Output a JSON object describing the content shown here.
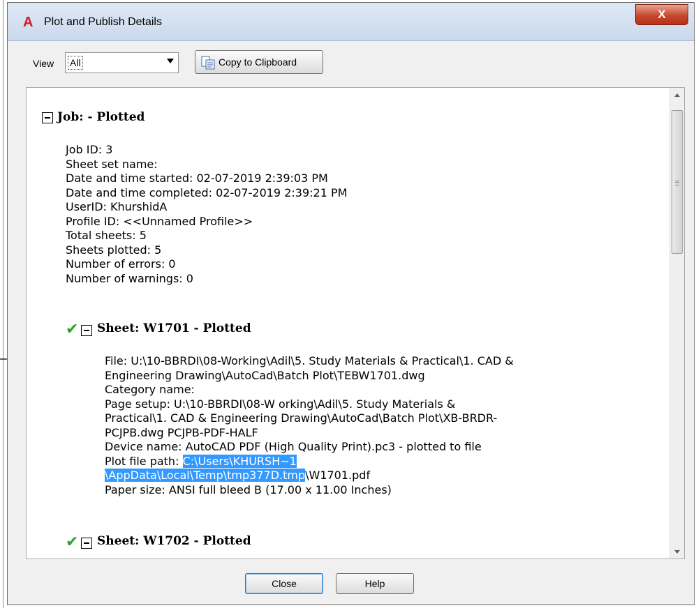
{
  "window": {
    "title": "Plot and Publish Details",
    "close_glyph": "X",
    "app_icon": "autocad-a-icon"
  },
  "toolbar": {
    "view_label": "View",
    "view_value": "All",
    "copy_label": "Copy to Clipboard"
  },
  "job": {
    "heading": "Job: - Plotted",
    "lines": [
      "Job ID: 3",
      "Sheet set name:",
      "Date and time started: 02-07-2019 2:39:03 PM",
      "Date and time completed: 02-07-2019 2:39:21 PM",
      "UserID: KhurshidA",
      "Profile ID: <<Unnamed Profile>>",
      "Total sheets: 5",
      "Sheets plotted: 5",
      "Number of errors: 0",
      "Number of warnings: 0"
    ]
  },
  "sheet1": {
    "heading": "Sheet: W1701 - Plotted",
    "lines": [
      "File: U:\\10-BBRDI\\08-Working\\Adil\\5. Study Materials & Practical\\1. CAD &",
      "Engineering Drawing\\AutoCad\\Batch Plot\\TEBW1701.dwg",
      "Category name:",
      "Page setup: U:\\10-BBRDI\\08-W orking\\Adil\\5. Study Materials &",
      "Practical\\1. CAD & Engineering Drawing\\AutoCad\\Batch Plot\\XB-BRDR-",
      "PCJPB.dwg PCJPB-PDF-HALF",
      "Device name: AutoCAD PDF (High Quality Print).pc3 - plotted to file"
    ],
    "plot_path_label": "Plot file path: ",
    "plot_path_hl1": "C:\\Users\\KHURSH~1",
    "plot_path_hl2": "\\AppData\\Local\\Temp\\tmp377D.tmp",
    "plot_path_rest": "\\W1701.pdf",
    "paper_size": "Paper size: ANSI full bleed B (17.00 x 11.00 Inches)"
  },
  "sheet2": {
    "heading": "Sheet: W1702 - Plotted"
  },
  "buttons": {
    "close": "Close",
    "help": "Help"
  },
  "colors": {
    "selection": "#3399ff",
    "check": "#2da12d",
    "close_button": "#c7482c"
  }
}
